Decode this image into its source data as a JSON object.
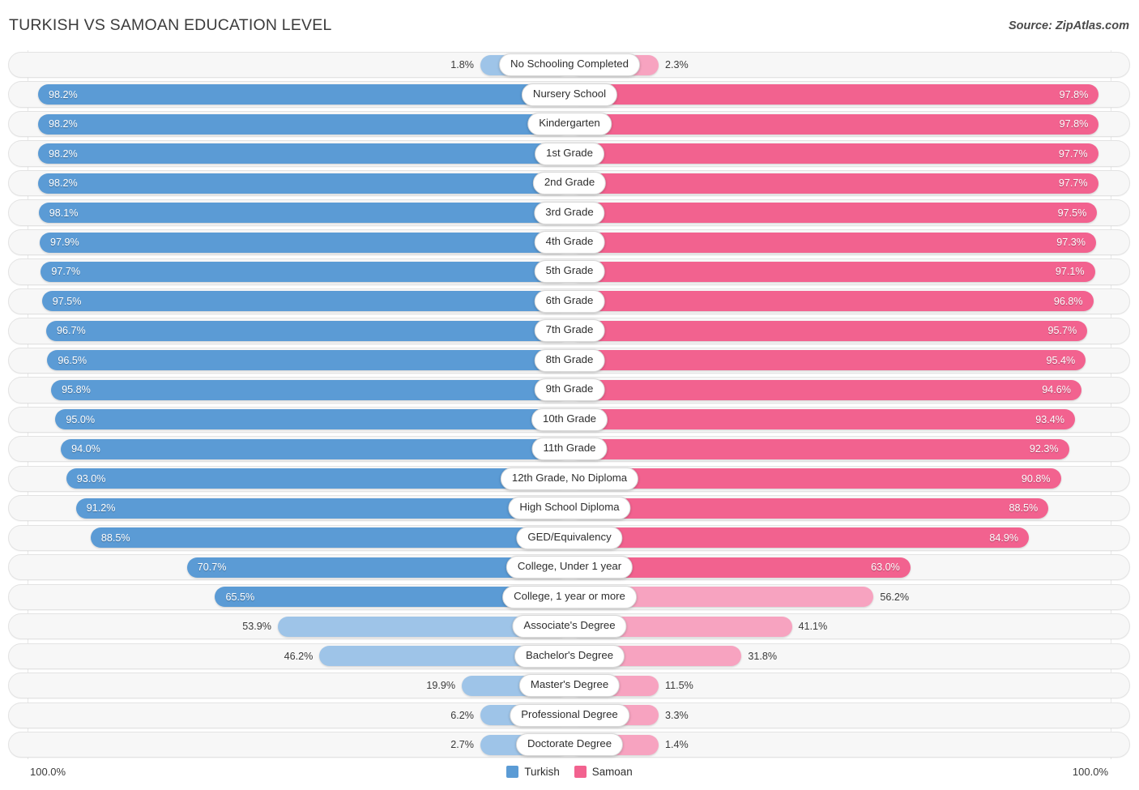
{
  "header": {
    "title": "TURKISH VS SAMOAN EDUCATION LEVEL",
    "source": "Source: ZipAtlas.com"
  },
  "footer": {
    "axis_left": "100.0%",
    "axis_right": "100.0%",
    "legend": [
      {
        "label": "Turkish",
        "color": "#5b9bd5"
      },
      {
        "label": "Samoan",
        "color": "#f2628f"
      }
    ]
  },
  "colors": {
    "turkish_strong": "#5b9bd5",
    "turkish_light": "#9ec4e8",
    "samoan_strong": "#f2628f",
    "samoan_light": "#f7a3c0",
    "track": "#f7f7f7",
    "track_border": "#e3e3e3"
  },
  "chart_data": {
    "type": "bar",
    "title": "TURKISH VS SAMOAN EDUCATION LEVEL",
    "subtitle": "Source: ZipAtlas.com",
    "orientation": "horizontal-diverging",
    "xlabel": "",
    "ylabel": "",
    "xlim": [
      0,
      100
    ],
    "axis_left_max": "100.0%",
    "axis_right_max": "100.0%",
    "grid": false,
    "legend_position": "bottom-center",
    "categories": [
      "No Schooling Completed",
      "Nursery School",
      "Kindergarten",
      "1st Grade",
      "2nd Grade",
      "3rd Grade",
      "4th Grade",
      "5th Grade",
      "6th Grade",
      "7th Grade",
      "8th Grade",
      "9th Grade",
      "10th Grade",
      "11th Grade",
      "12th Grade, No Diploma",
      "High School Diploma",
      "GED/Equivalency",
      "College, Under 1 year",
      "College, 1 year or more",
      "Associate's Degree",
      "Bachelor's Degree",
      "Master's Degree",
      "Professional Degree",
      "Doctorate Degree"
    ],
    "series": [
      {
        "name": "Turkish",
        "color": "#5b9bd5",
        "values": [
          1.8,
          98.2,
          98.2,
          98.2,
          98.2,
          98.1,
          97.9,
          97.7,
          97.5,
          96.7,
          96.5,
          95.8,
          95.0,
          94.0,
          93.0,
          91.2,
          88.5,
          70.7,
          65.5,
          53.9,
          46.2,
          19.9,
          6.2,
          2.7
        ],
        "labels": [
          "1.8%",
          "98.2%",
          "98.2%",
          "98.2%",
          "98.2%",
          "98.1%",
          "97.9%",
          "97.7%",
          "97.5%",
          "96.7%",
          "96.5%",
          "95.8%",
          "95.0%",
          "94.0%",
          "93.0%",
          "91.2%",
          "88.5%",
          "70.7%",
          "65.5%",
          "53.9%",
          "46.2%",
          "19.9%",
          "6.2%",
          "2.7%"
        ]
      },
      {
        "name": "Samoan",
        "color": "#f2628f",
        "values": [
          2.3,
          97.8,
          97.8,
          97.7,
          97.7,
          97.5,
          97.3,
          97.1,
          96.8,
          95.7,
          95.4,
          94.6,
          93.4,
          92.3,
          90.8,
          88.5,
          84.9,
          63.0,
          56.2,
          41.1,
          31.8,
          11.5,
          3.3,
          1.4
        ],
        "labels": [
          "2.3%",
          "97.8%",
          "97.8%",
          "97.7%",
          "97.7%",
          "97.5%",
          "97.3%",
          "97.1%",
          "96.8%",
          "95.7%",
          "95.4%",
          "94.6%",
          "93.4%",
          "92.3%",
          "90.8%",
          "88.5%",
          "84.9%",
          "63.0%",
          "56.2%",
          "41.1%",
          "31.8%",
          "11.5%",
          "3.3%",
          "1.4%"
        ]
      }
    ]
  }
}
